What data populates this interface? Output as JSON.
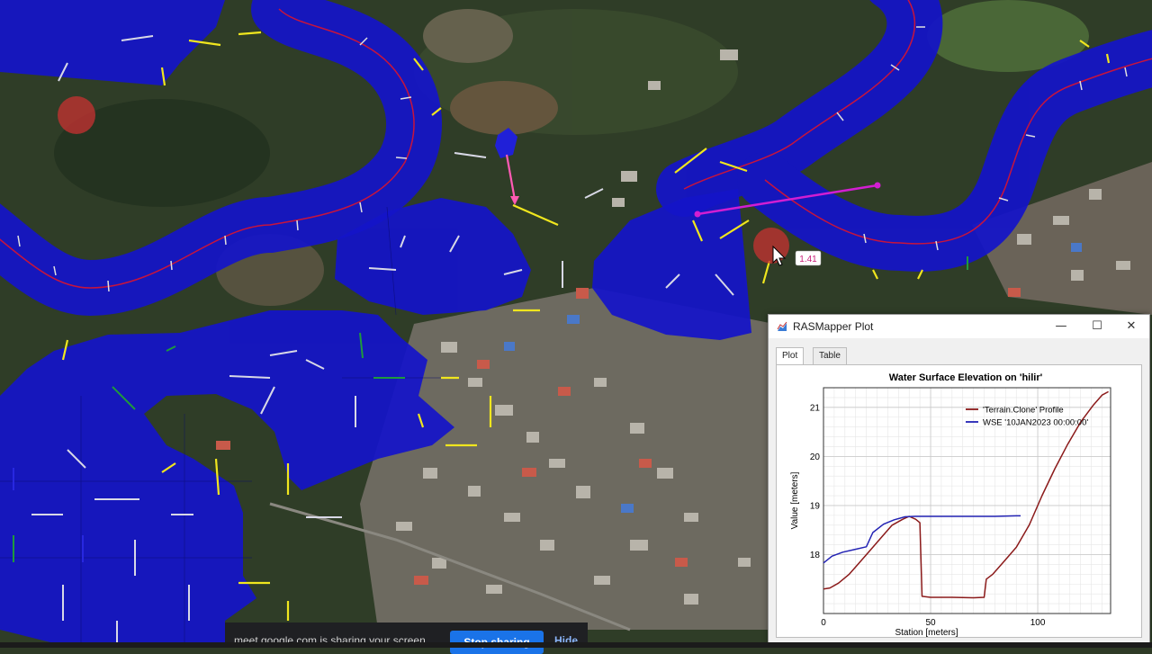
{
  "map": {
    "cursor_value": "1.41",
    "colors": {
      "water": "#1414c8",
      "centerline": "#c8143c",
      "profile_line": "#d21ed2",
      "pink_arrow": "#ff5ab4",
      "arrow_white": "#d8d8e6",
      "arrow_yellow": "#f0e61e",
      "arrow_green": "#1e9a3c",
      "marker": "#c83232"
    }
  },
  "window": {
    "title": "RASMapper Plot",
    "minimize": "—",
    "maximize": "☐",
    "close": "✕",
    "tabs": [
      {
        "label": "Plot",
        "active": true
      },
      {
        "label": "Table",
        "active": false
      }
    ]
  },
  "chart_data": {
    "type": "line",
    "title": "Water Surface Elevation on 'hilir'",
    "xlabel": "Station [meters]",
    "ylabel": "Value [meters]",
    "xlim": [
      0,
      134
    ],
    "ylim": [
      16.8,
      21.4
    ],
    "xticks": [
      "0",
      "50",
      "100"
    ],
    "yticks": [
      "18",
      "19",
      "20",
      "21"
    ],
    "grid": true,
    "legend_position": "top-right",
    "series": [
      {
        "name": "'Terrain.Clone' Profile",
        "color": "#8b1a1a",
        "x": [
          0,
          3,
          7,
          12,
          17,
          22,
          27,
          32,
          37,
          40,
          43,
          45,
          46,
          50,
          60,
          70,
          75,
          76,
          79,
          84,
          90,
          96,
          102,
          108,
          114,
          120,
          126,
          130,
          133
        ],
        "y": [
          17.3,
          17.32,
          17.42,
          17.6,
          17.85,
          18.1,
          18.35,
          18.6,
          18.72,
          18.78,
          18.72,
          18.65,
          17.15,
          17.13,
          17.13,
          17.12,
          17.13,
          17.5,
          17.6,
          17.85,
          18.15,
          18.6,
          19.2,
          19.75,
          20.25,
          20.7,
          21.05,
          21.25,
          21.32
        ]
      },
      {
        "name": "WSE '10JAN2023 00:00:00'",
        "color": "#2323b4",
        "x": [
          0,
          4,
          9,
          14,
          20,
          23,
          28,
          33,
          38,
          43,
          50,
          60,
          70,
          80,
          90,
          92
        ],
        "y": [
          17.83,
          17.97,
          18.05,
          18.1,
          18.16,
          18.45,
          18.62,
          18.71,
          18.77,
          18.78,
          18.78,
          18.78,
          18.78,
          18.78,
          18.79,
          18.79
        ]
      }
    ]
  },
  "share_bar": {
    "message": "meet.google.com is sharing your screen.",
    "stop_label": "Stop sharing",
    "hide_label": "Hide"
  }
}
